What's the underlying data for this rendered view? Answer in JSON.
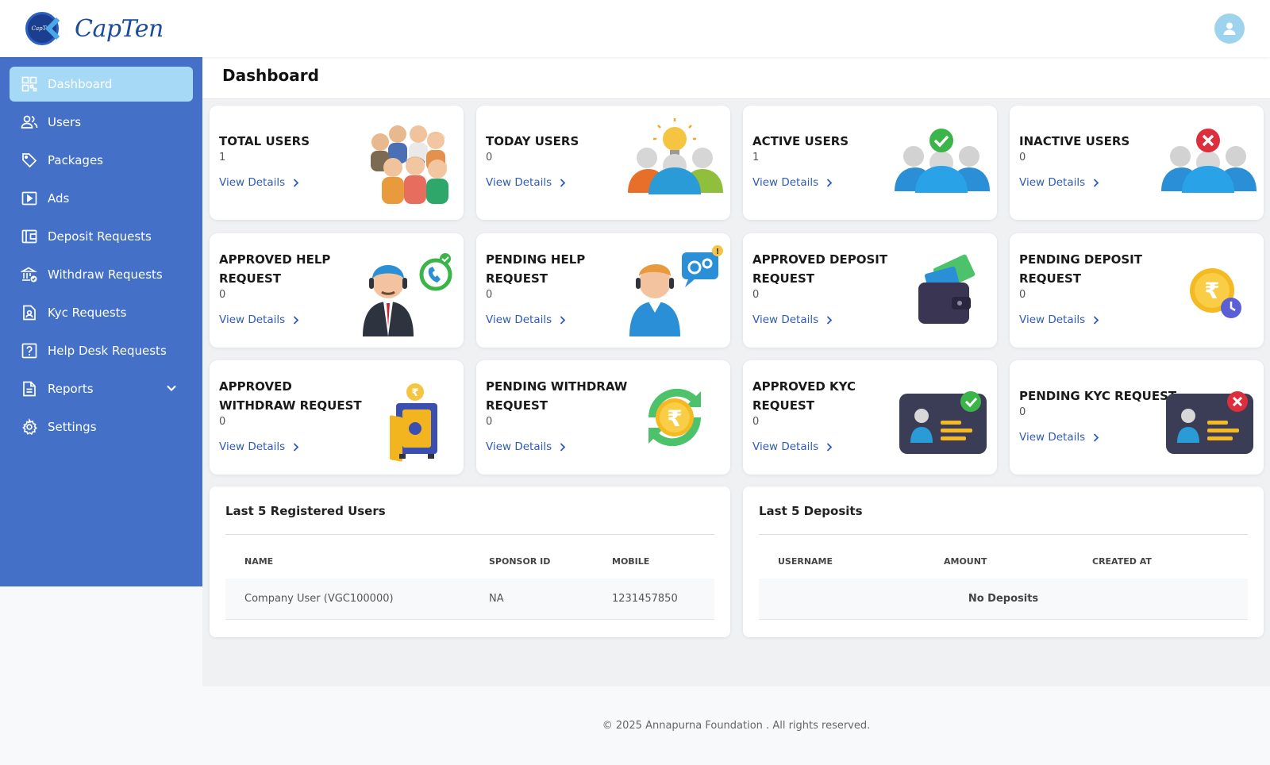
{
  "brand": {
    "name": "CapTen",
    "badge_text": "CapTen"
  },
  "sidebar": {
    "items": [
      {
        "label": "Dashboard",
        "icon": "dashboard-icon",
        "active": true
      },
      {
        "label": "Users",
        "icon": "users-icon"
      },
      {
        "label": "Packages",
        "icon": "tag-icon"
      },
      {
        "label": "Ads",
        "icon": "play-icon"
      },
      {
        "label": "Deposit Requests",
        "icon": "wallet-icon"
      },
      {
        "label": "Withdraw Requests",
        "icon": "bank-icon"
      },
      {
        "label": "Kyc Requests",
        "icon": "id-document-icon"
      },
      {
        "label": "Help Desk Requests",
        "icon": "question-icon"
      },
      {
        "label": "Reports",
        "icon": "report-icon",
        "has_submenu": true
      },
      {
        "label": "Settings",
        "icon": "gear-icon"
      }
    ]
  },
  "page": {
    "title": "Dashboard"
  },
  "cards": [
    {
      "title": "TOTAL USERS",
      "value": "1",
      "link": "View Details"
    },
    {
      "title": "TODAY USERS",
      "value": "0",
      "link": "View Details"
    },
    {
      "title": "ACTIVE USERS",
      "value": "1",
      "link": "View Details"
    },
    {
      "title": "INACTIVE USERS",
      "value": "0",
      "link": "View Details"
    },
    {
      "title": "APPROVED HELP REQUEST",
      "value": "0",
      "link": "View Details"
    },
    {
      "title": "PENDING HELP REQUEST",
      "value": "0",
      "link": "View Details"
    },
    {
      "title": "APPROVED DEPOSIT REQUEST",
      "value": "0",
      "link": "View Details"
    },
    {
      "title": "PENDING DEPOSIT REQUEST",
      "value": "0",
      "link": "View Details"
    },
    {
      "title": "APPROVED WITHDRAW REQUEST",
      "value": "0",
      "link": "View Details"
    },
    {
      "title": "PENDING WITHDRAW REQUEST",
      "value": "0",
      "link": "View Details"
    },
    {
      "title": "APPROVED KYC REQUEST",
      "value": "0",
      "link": "View Details"
    },
    {
      "title": "PENDING KYC REQUEST",
      "value": "0",
      "link": "View Details"
    }
  ],
  "registered_users": {
    "title": "Last 5 Registered Users",
    "columns": [
      "NAME",
      "SPONSOR ID",
      "MOBILE"
    ],
    "rows": [
      [
        "Company User (VGC100000)",
        "NA",
        "1231457850"
      ]
    ]
  },
  "deposits": {
    "title": "Last 5 Deposits",
    "columns": [
      "USERNAME",
      "AMOUNT",
      "CREATED AT"
    ],
    "empty_text": "No Deposits"
  },
  "footer": {
    "text": "© 2025 Annapurna Foundation . All rights reserved."
  },
  "colors": {
    "sidebar": "#4470c8",
    "active_item": "#a6d9f5",
    "link": "#2f5bb8"
  }
}
